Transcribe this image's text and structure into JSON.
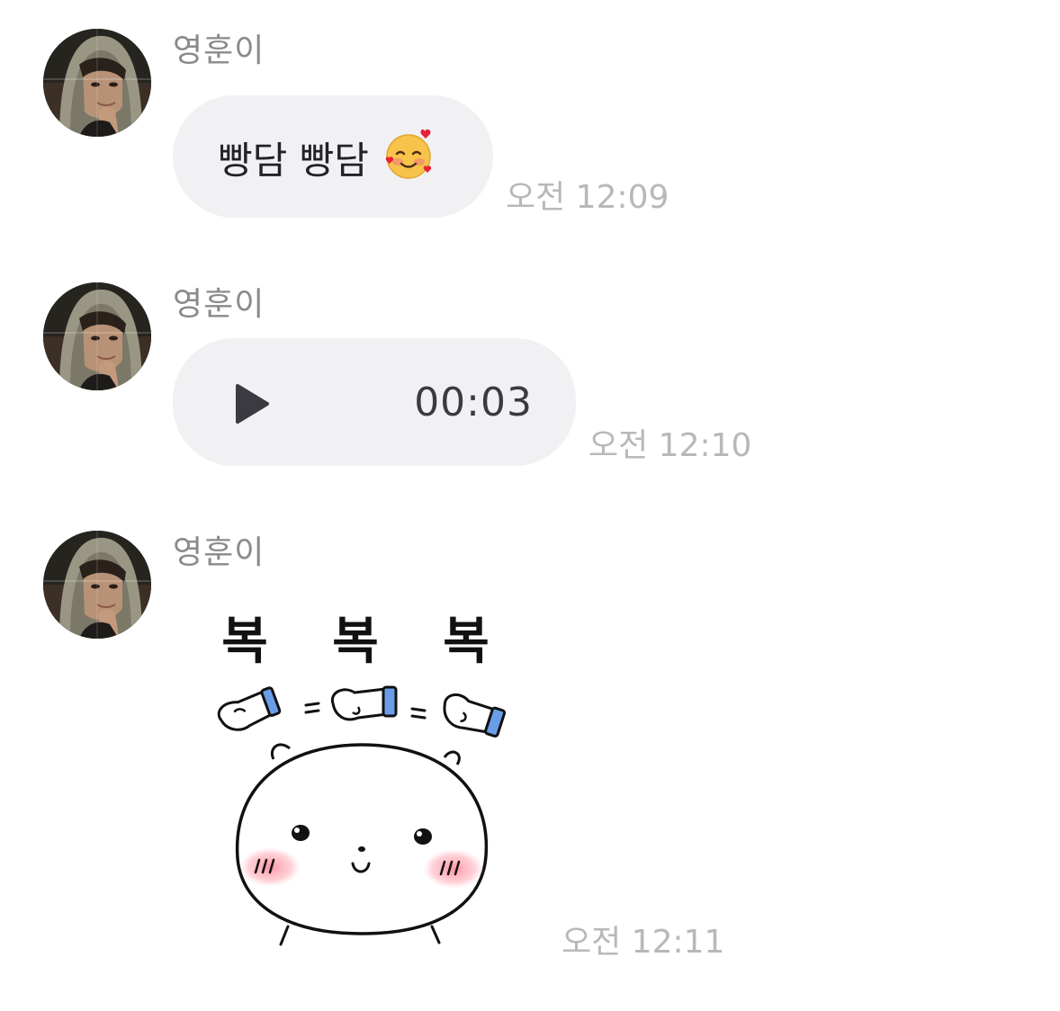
{
  "messages": [
    {
      "sender": "영훈이",
      "type": "text",
      "text": "빵담 빵담",
      "emoji": "smiling-face-with-hearts-icon",
      "time": "오전 12:09"
    },
    {
      "sender": "영훈이",
      "type": "voice",
      "duration": "00:03",
      "icon": "play-icon",
      "time": "오전 12:10"
    },
    {
      "sender": "영훈이",
      "type": "sticker",
      "sticker_text": "복 복 복",
      "time": "오전 12:11"
    }
  ],
  "colors": {
    "bubble": "#f1f1f3",
    "sender": "#8a8a8e",
    "timestamp": "#b8b8bc",
    "text": "#222226",
    "play": "#3a3a40",
    "mitten_cuff": "#6a9de8",
    "blush": "#ff9aa8"
  }
}
